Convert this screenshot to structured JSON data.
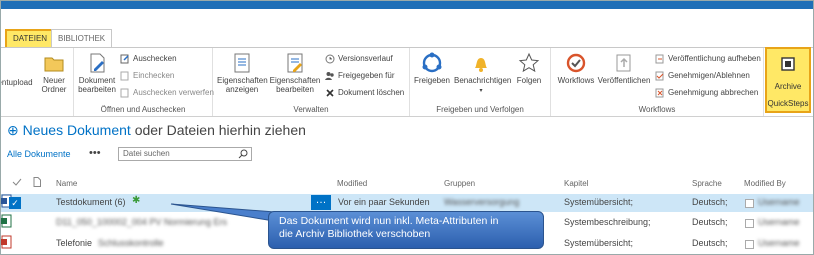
{
  "tabs": {
    "files": "DATEIEN",
    "library": "BIBLIOTHEK"
  },
  "ribbon": {
    "upload_partial": "entupload",
    "new_folder": [
      "Neuer",
      "Ordner"
    ],
    "edit_document": [
      "Dokument",
      "bearbeiten"
    ],
    "checkout": "Auschecken",
    "checkin": "Einchecken",
    "discard_checkout": "Auschecken verwerfen",
    "group_open_checkout": "Öffnen und Auschecken",
    "properties_view": [
      "Eigenschaften",
      "anzeigen"
    ],
    "properties_edit": [
      "Eigenschaften",
      "bearbeiten"
    ],
    "version_history": "Versionsverlauf",
    "shared_with": "Freigegeben für",
    "delete_document": "Dokument löschen",
    "group_manage": "Verwalten",
    "share": "Freigeben",
    "alert_me": "Benachrichtigen",
    "follow": "Folgen",
    "group_share_track": "Freigeben und Verfolgen",
    "workflows": "Workflows",
    "publish": "Veröffentlichen",
    "unpublish": "Veröffentlichung aufheben",
    "approve_reject": "Genehmigen/Ablehnen",
    "cancel_approval": "Genehmigung abbrechen",
    "group_workflows": "Workflows",
    "archive": "Archive",
    "group_quicksteps": "QuickSteps"
  },
  "main": {
    "new_document": "Neues Dokument",
    "or_drag": "oder Dateien hierhin ziehen",
    "view": "Alle Dokumente",
    "more": "•••",
    "search_placeholder": "Datei suchen"
  },
  "columns": [
    "Name",
    "Modified",
    "Gruppen",
    "Kapitel",
    "Sprache",
    "Modified By"
  ],
  "rows": [
    {
      "name": "Testdokument (6)",
      "modified": "Vor ein paar Sekunden",
      "gruppen": "Wasserversorgung",
      "kapitel": "Systemübersicht;",
      "sprache": "Deutsch;",
      "by": "Username"
    },
    {
      "name": "D11_050_100002_004 PV Normierung Ers",
      "modified": "",
      "gruppen": "",
      "kapitel": "Systembeschreibung;",
      "sprache": "Deutsch;",
      "by": "Username"
    },
    {
      "name": "Telefonie",
      "name_suffix": "Schlusskontrolle",
      "modified": "",
      "gruppen": "",
      "kapitel": "Systemübersicht;",
      "sprache": "Deutsch;",
      "by": "Username"
    }
  ],
  "callout": {
    "line1": "Das Dokument wird nun inkl. Meta-Attributen in",
    "line2": "die Archiv Bibliothek verschoben"
  },
  "colors": {
    "accent": "#0072c6",
    "highlight": "#ffe866",
    "highlight_border": "#e8a418",
    "selected_row": "#cde6f7",
    "callout": "#3a6fc0"
  }
}
